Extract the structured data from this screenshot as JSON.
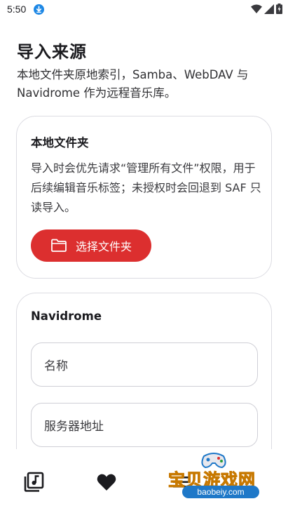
{
  "status_bar": {
    "time": "5:50"
  },
  "header": {
    "title": "导入来源",
    "subtitle": "本地文件夹原地索引，Samba、WebDAV 与 Navidrome 作为远程音乐库。"
  },
  "local_card": {
    "title": "本地文件夹",
    "description": "导入时会优先请求“管理所有文件”权限，用于后续编辑音乐标签；未授权时会回退到 SAF 只读导入。",
    "button_label": "选择文件夹"
  },
  "navidrome_card": {
    "title": "Navidrome",
    "name_placeholder": "名称",
    "server_placeholder": "服务器地址"
  },
  "bottom_nav": {
    "items": [
      {
        "icon": "music-library-icon"
      },
      {
        "icon": "heart-icon"
      },
      {
        "icon": "menu-icon"
      }
    ]
  },
  "watermark": {
    "text": "宝贝游戏网",
    "url": "baobeiy.com"
  },
  "colors": {
    "accent": "#dc2f2f",
    "download_badge": "#1e88e5"
  }
}
